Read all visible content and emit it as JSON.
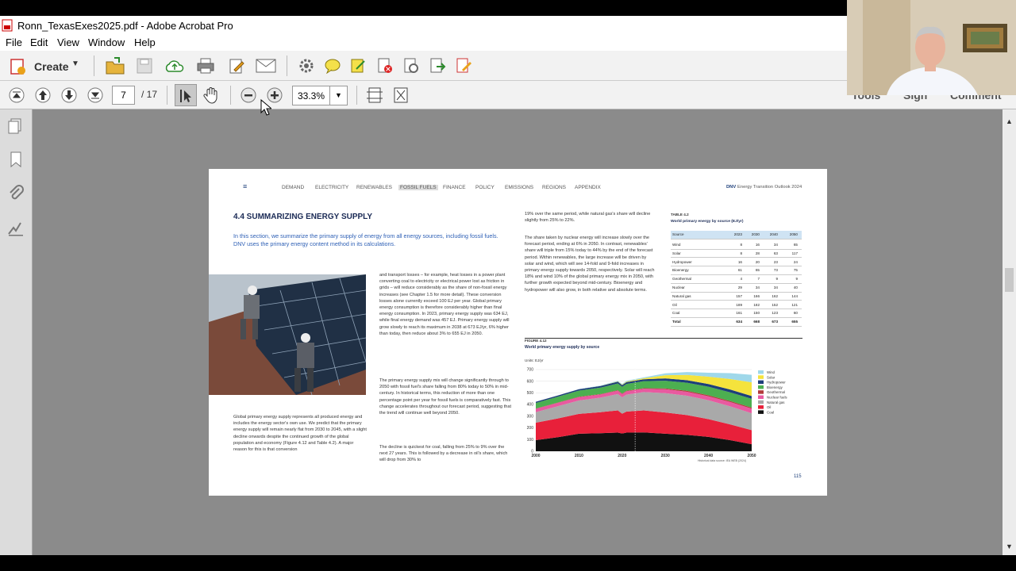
{
  "window": {
    "title": "Ronn_TexasExes2025.pdf - Adobe Acrobat Pro"
  },
  "menu": {
    "file": "File",
    "edit": "Edit",
    "view": "View",
    "window": "Window",
    "help": "Help"
  },
  "toolbar": {
    "create_label": "Create",
    "page_current": "7",
    "page_total": "/ 17",
    "zoom": "33.3%",
    "tools": "Tools",
    "sign": "Sign",
    "comment": "Comment"
  },
  "doc": {
    "nav": [
      "DEMAND",
      "ELECTRICITY",
      "RENEWABLES",
      "FOSSIL FUELS",
      "FINANCE",
      "POLICY",
      "EMISSIONS",
      "REGIONS",
      "APPENDIX"
    ],
    "brand": "DNV",
    "header_title": "Energy Transition Outlook 2024",
    "section_title": "4.4 SUMMARIZING ENERGY SUPPLY",
    "intro": "In this section, we summarize the primary supply of energy from all energy sources, including fossil fuels. DNV uses the primary energy content method in its calculations.",
    "col1_bottom": "Global primary energy supply represents all produced energy and includes the energy sector's own use. We predict that the primary energy supply will remain nearly flat from 2030 to 2045, with a slight decline onwards despite the continued growth of the global population and economy (Figure 4.12 and Table 4.2). A major reason for this is that conversion",
    "col2_p1": "and transport losses – for example, heat losses in a power plant converting coal to electricity or electrical power lost as friction in grids – will reduce considerably as the share of non-fossil energy increases (see Chapter 1.5 for more detail). These conversion losses alone currently exceed 100 EJ per year. Global primary energy consumption is therefore considerably higher than final energy consumption. In 2023, primary energy supply was 634 EJ, while final energy demand was 457 EJ. Primary energy supply will grow slowly to reach its maximum in 2038 at 673 EJ/yr, 6% higher than today, then reduce about 3% to 655 EJ in 2050.",
    "col2_p2": "The primary energy supply mix will change significantly through to 2050 with fossil fuel's share falling from 80% today to 50% in mid-century. In historical terms, this reduction of more than one percentage point per year for fossil fuels is comparatively fast. This change accelerates throughout our forecast period, suggesting that the trend will continue well beyond 2050.",
    "col2_p3": "The decline is quickest for coal, falling from 25% to 9% over the next 27 years. This is followed by a decrease in oil's share, which will drop from 30% to",
    "col3_p1": "19% over the same period, while natural gas's share will decline slightly from 25% to 22%.",
    "col3_p2": "The share taken by nuclear energy will increase slowly over the forecast period, ending at 6% in 2050. In contrast, renewables' share will triple from 15% today to 44% by the end of the forecast period. Within renewables, the large increase will be driven by solar and wind, which will see 14-fold and 9-fold increases in primary energy supply towards 2050, respectively. Solar will reach 18% and wind 10% of the global primary energy mix in 2050, with further growth expected beyond mid-century. Bioenergy and hydropower will also grow, in both relative and absolute terms.",
    "table": {
      "label": "TABLE 4.2",
      "title": "World primary energy by source (EJ/yr)",
      "headers": [
        "Source",
        "2023",
        "2030",
        "2040",
        "2050"
      ],
      "rows": [
        [
          "Wind",
          "8",
          "16",
          "34",
          "65"
        ],
        [
          "Solar",
          "8",
          "28",
          "63",
          "117"
        ],
        [
          "Hydropower",
          "16",
          "20",
          "23",
          "24"
        ],
        [
          "Bioenergy",
          "61",
          "65",
          "73",
          "75"
        ],
        [
          "Geothermal",
          "4",
          "7",
          "9",
          "9"
        ],
        [
          "Nuclear",
          "29",
          "34",
          "34",
          "40"
        ],
        [
          "Natural gas",
          "157",
          "166",
          "162",
          "144"
        ],
        [
          "Oil",
          "189",
          "182",
          "152",
          "121"
        ],
        [
          "Coal",
          "161",
          "150",
          "123",
          "60"
        ],
        [
          "Total",
          "634",
          "668",
          "673",
          "655"
        ]
      ]
    },
    "figure": {
      "label": "FIGURE 4.12",
      "title": "World primary energy supply by source",
      "units": "Units: EJ/yr",
      "source": "Historical data source: IEA WEB (2024)"
    },
    "page_number": "115"
  },
  "chart_data": {
    "type": "area",
    "x": [
      2000,
      2005,
      2010,
      2015,
      2019,
      2020,
      2021,
      2025,
      2030,
      2035,
      2040,
      2045,
      2050
    ],
    "ylim": [
      0,
      700
    ],
    "yticks": [
      0,
      100,
      200,
      300,
      400,
      500,
      600,
      700
    ],
    "xticks": [
      2000,
      2010,
      2020,
      2030,
      2040,
      2050
    ],
    "series": [
      {
        "name": "Coal",
        "color": "#111111",
        "values": [
          95,
          120,
          150,
          155,
          160,
          152,
          160,
          161,
          150,
          140,
          123,
          95,
          60
        ]
      },
      {
        "name": "Oil",
        "color": "#e8203a",
        "values": [
          150,
          160,
          170,
          180,
          190,
          170,
          180,
          189,
          182,
          170,
          152,
          135,
          121
        ]
      },
      {
        "name": "Natural gas",
        "color": "#a9a9a9",
        "values": [
          90,
          105,
          115,
          125,
          140,
          140,
          145,
          157,
          166,
          166,
          162,
          155,
          144
        ]
      },
      {
        "name": "Nuclear fuels",
        "color": "#e85aa0",
        "values": [
          29,
          29,
          29,
          27,
          29,
          28,
          29,
          29,
          34,
          34,
          34,
          37,
          40
        ]
      },
      {
        "name": "Geothermal",
        "color": "#b23a3a",
        "values": [
          2,
          2,
          3,
          3,
          4,
          4,
          4,
          4,
          7,
          8,
          9,
          9,
          9
        ]
      },
      {
        "name": "Bioenergy",
        "color": "#4caf50",
        "values": [
          48,
          50,
          53,
          55,
          58,
          58,
          59,
          61,
          65,
          69,
          73,
          74,
          75
        ]
      },
      {
        "name": "Hydropower",
        "color": "#1d3f7a",
        "values": [
          10,
          11,
          12,
          14,
          15,
          15,
          15,
          16,
          20,
          22,
          23,
          24,
          24
        ]
      },
      {
        "name": "Solar",
        "color": "#f5e33c",
        "values": [
          0,
          0,
          0,
          1,
          3,
          4,
          5,
          8,
          28,
          45,
          63,
          90,
          117
        ]
      },
      {
        "name": "Wind",
        "color": "#9fd8ea",
        "values": [
          0,
          0,
          1,
          3,
          5,
          6,
          7,
          8,
          16,
          25,
          34,
          50,
          65
        ]
      }
    ],
    "legend": [
      "Wind",
      "Solar",
      "Hydropower",
      "Bioenergy",
      "Geothermal",
      "Nuclear fuels",
      "Natural gas",
      "Oil",
      "Coal"
    ]
  }
}
